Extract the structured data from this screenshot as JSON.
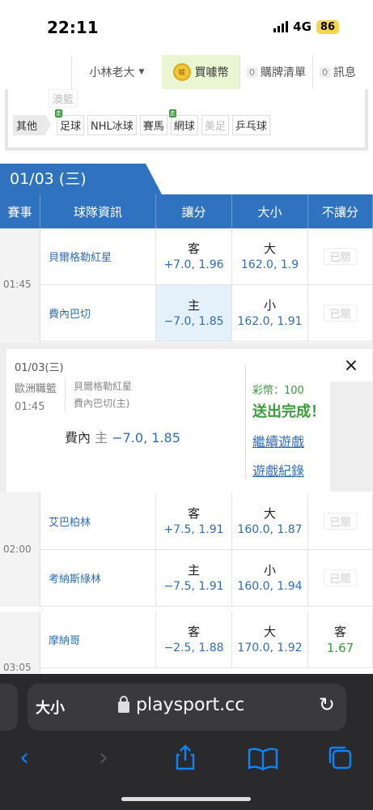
{
  "status": {
    "time": "22:11",
    "network": "4G",
    "battery": "86"
  },
  "nav": {
    "user": "小林老大",
    "buy": "買噱幣",
    "cart_count": "0",
    "cart": "購牌清單",
    "msg_count": "0",
    "msg": "訊息"
  },
  "sports": {
    "prev": "澳籃",
    "other": "其他",
    "items": [
      "足球",
      "NHL冰球",
      "賽馬",
      "網球",
      "美足",
      "乒乓球"
    ],
    "live": "走"
  },
  "date": "01/03 (三)",
  "headers": [
    "賽事",
    "球隊資訊",
    "讓分",
    "大小",
    "不讓分"
  ],
  "closed": "已關",
  "games": [
    {
      "time": "01:45",
      "rows": [
        {
          "team": "貝爾格勒紅星",
          "spread_side": "客",
          "spread": "+7.0, 1.96",
          "total_side": "大",
          "total": "162.0, 1.9"
        },
        {
          "team": "費內巴切",
          "spread_side": "主",
          "spread": "−7.0, 1.85",
          "total_side": "小",
          "total": "162.0, 1.91"
        }
      ]
    },
    {
      "time": "02:00",
      "rows": [
        {
          "team": "艾巴柏林",
          "spread_side": "客",
          "spread": "+7.5, 1.91",
          "total_side": "大",
          "total": "160.0, 1.87"
        },
        {
          "team": "考納斯綠林",
          "spread_side": "主",
          "spread": "−7.5, 1.91",
          "total_side": "小",
          "total": "160.0, 1.94"
        }
      ]
    },
    {
      "time": "03:05",
      "rows": [
        {
          "team": "摩納哥",
          "spread_side": "客",
          "spread": "−2.5, 1.88",
          "total_side": "大",
          "total": "170.0, 1.92",
          "ml_side": "客",
          "ml": "1.67"
        }
      ]
    }
  ],
  "confirm": {
    "date": "01/03(三)",
    "league": "歐洲職籃",
    "time": "01:45",
    "team_away": "貝爾格勒紅星",
    "team_home": "費內巴切(主)",
    "pick_team": "費內",
    "pick_side": "主",
    "pick_value": "−7.0, 1.85",
    "coins": "彩幣：100",
    "done": "送出完成！",
    "continue": "繼續遊戲",
    "history": "遊戲紀錄",
    "close": "×"
  },
  "browser": {
    "aa": "大小",
    "host": "playsport.cc"
  }
}
